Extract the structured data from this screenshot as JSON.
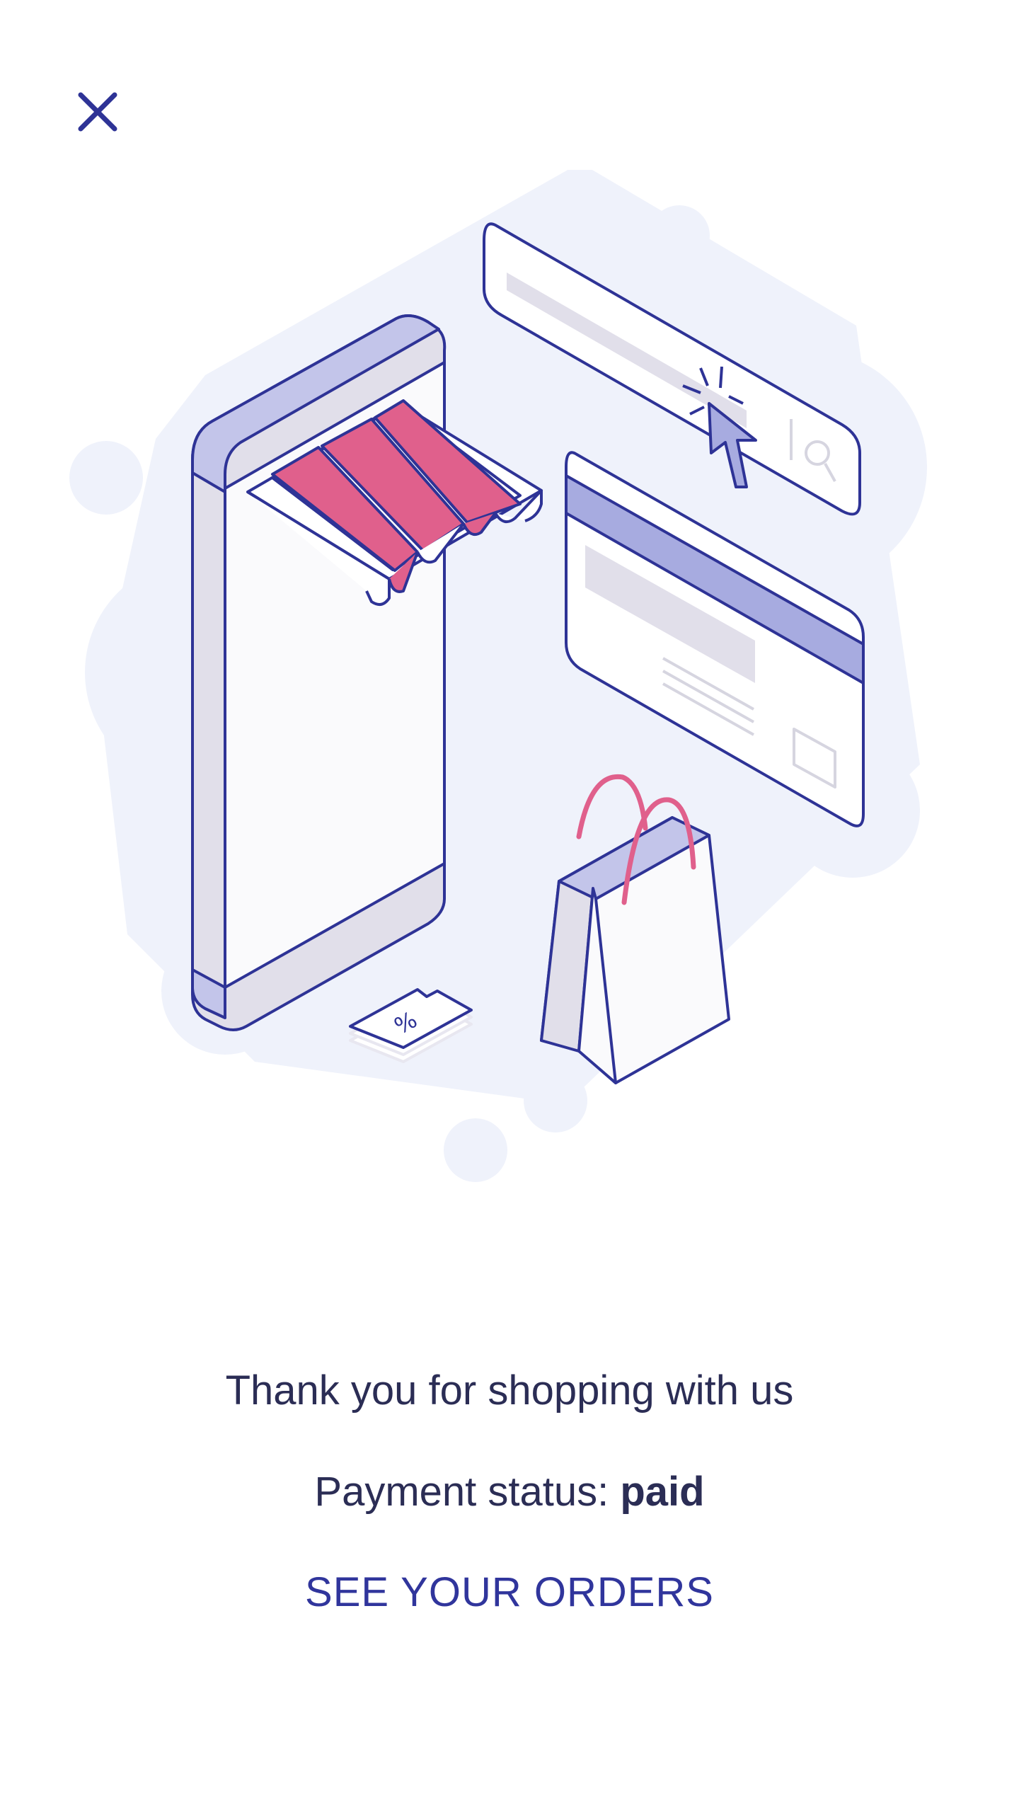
{
  "header": {
    "close_icon": "close-icon"
  },
  "illustration": {
    "subject": "shopping-illustration",
    "colors": {
      "outline": "#2e3396",
      "accent_pink": "#e0608c",
      "lavender": "#c3c5ea",
      "light_gray": "#e1dfea",
      "bg_blob": "#eff2fb"
    }
  },
  "confirmation": {
    "thank_you": "Thank you for shopping with us",
    "payment_label": "Payment status: ",
    "payment_value": "paid"
  },
  "actions": {
    "see_orders": "SEE YOUR ORDERS"
  }
}
